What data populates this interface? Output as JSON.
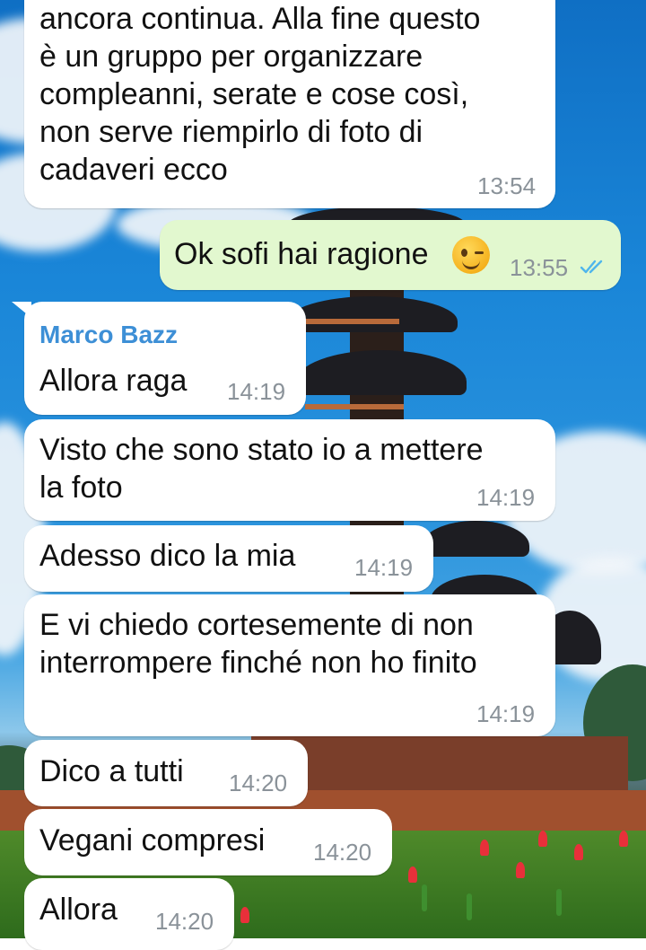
{
  "messages": [
    {
      "id": "m1",
      "direction": "in",
      "text": "ancora continua. Alla fine questo\nè un gruppo per organizzare\ncompleanni, serate e cose così,\nnon serve riempirlo di foto di\ncadaveri ecco",
      "time": "13:54"
    },
    {
      "id": "m2",
      "direction": "out",
      "text": "Ok sofi hai ragione",
      "emoji": "winking-face",
      "time": "13:55",
      "status": "read-double-check"
    },
    {
      "id": "m3",
      "direction": "in",
      "sender": "Marco Bazz",
      "text": "Allora raga",
      "time": "14:19"
    },
    {
      "id": "m4",
      "direction": "in",
      "text": "Visto che sono stato io a mettere\nla foto",
      "time": "14:19"
    },
    {
      "id": "m5",
      "direction": "in",
      "text": "Adesso dico la mia",
      "time": "14:19"
    },
    {
      "id": "m6",
      "direction": "in",
      "text": "E vi chiedo cortesemente di non\ninterrompere finché non ho finito",
      "time": "14:19"
    },
    {
      "id": "m7",
      "direction": "in",
      "text": "Dico a tutti",
      "time": "14:20"
    },
    {
      "id": "m8",
      "direction": "in",
      "text": "Vegani compresi",
      "time": "14:20"
    },
    {
      "id": "m9",
      "direction": "in",
      "text": "Allora",
      "time": "14:20"
    }
  ],
  "colors": {
    "incoming_bubble": "#ffffff",
    "outgoing_bubble": "#e2f8cf",
    "sender_name": "#3d8fd6",
    "timestamp": "#8a9299",
    "read_ticks": "#4fb6ec"
  }
}
